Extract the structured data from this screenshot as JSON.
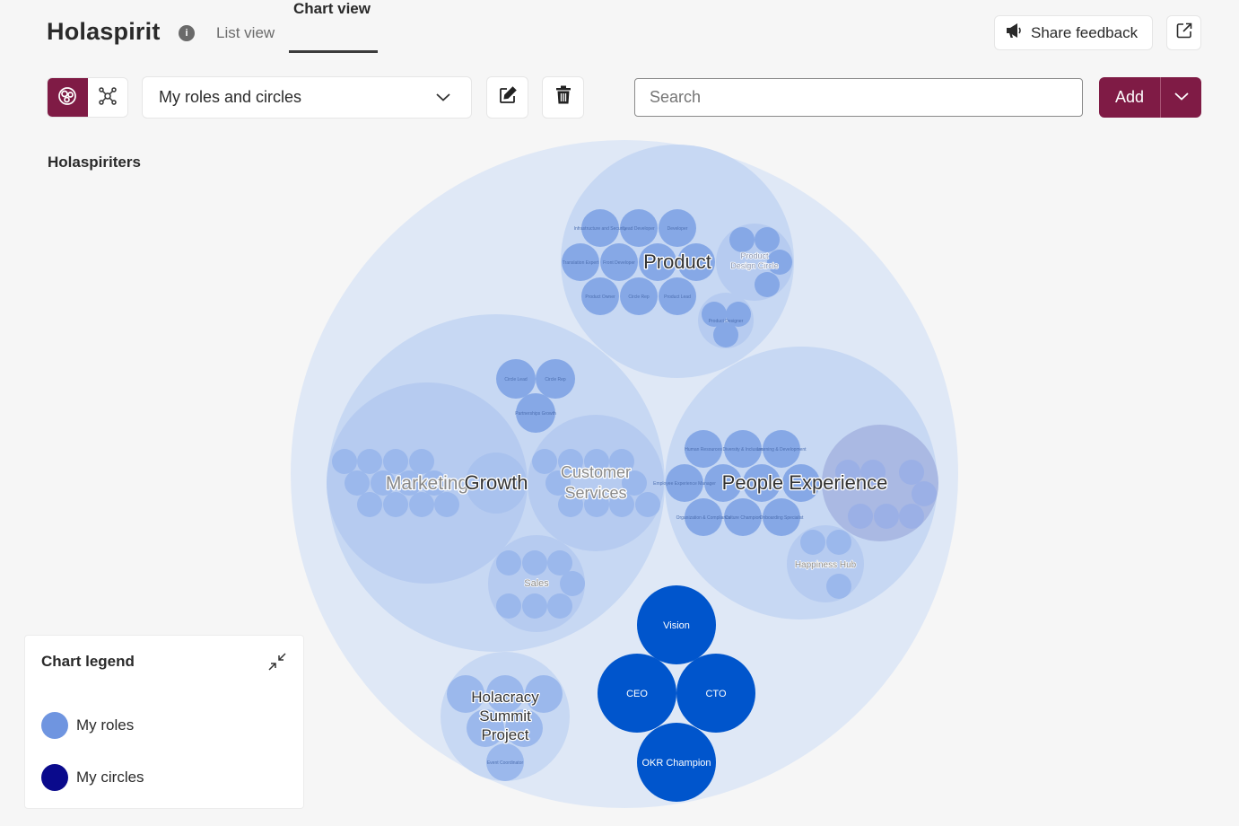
{
  "header": {
    "app_title": "Holaspirit",
    "info_glyph": "i",
    "tabs": [
      {
        "label": "List view",
        "active": false
      },
      {
        "label": "Chart view",
        "active": true
      }
    ],
    "feedback_label": "Share feedback"
  },
  "toolbar": {
    "filter_selected": "My roles and circles",
    "search_placeholder": "Search",
    "add_label": "Add"
  },
  "org": {
    "name": "Holaspiriters"
  },
  "legend": {
    "title": "Chart legend",
    "items": [
      {
        "label": "My roles",
        "color": "#6f95e0"
      },
      {
        "label": "My circles",
        "color": "#0a0a8c"
      }
    ]
  },
  "colors": {
    "brand": "#7f1b45",
    "my_role": "#0055cc",
    "circle_fill": "#a9c2ee"
  },
  "chart": {
    "circle_labels": {
      "product": "Product",
      "product_design": "Product Design Circle",
      "growth": "Growth",
      "marketing": "Marketing",
      "customer_services": "Customer Services",
      "sales": "Sales",
      "people_experience": "People Experience",
      "happiness_hub": "Happiness Hub",
      "holacracy_summit": "Holacracy Summit Project"
    },
    "small_roles": {
      "product": [
        "Infrastructure and Security",
        "Lead Developer",
        "Developer",
        "Translation Expert",
        "Front Developer",
        "Product Owner",
        "Circle Rep",
        "Product Lead"
      ],
      "product_design": [
        "Product Designer"
      ],
      "growth": [
        "Circle Lead",
        "Circle Rep",
        "Partnerships Growth"
      ],
      "people_experience": [
        "Human Resources",
        "Diversity & Inclusion",
        "Learning & Development",
        "Employee Experience Manager",
        "Organization & Compliance",
        "Culture Champion",
        "Onboarding Specialist"
      ],
      "holacracy_summit": [
        "Event Coordinator"
      ]
    },
    "my_roles": [
      "Vision",
      "CEO",
      "CTO",
      "OKR Champion"
    ]
  }
}
